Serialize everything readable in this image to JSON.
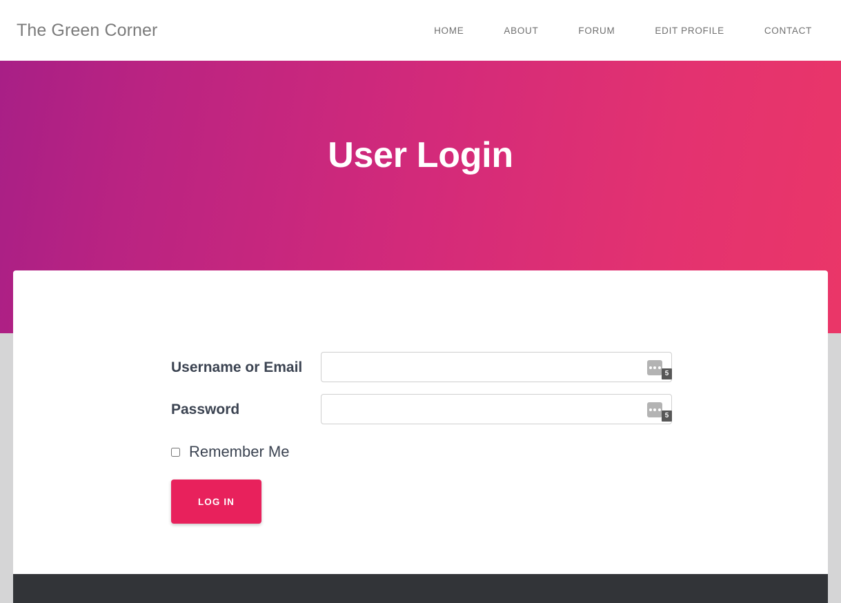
{
  "header": {
    "site_title": "The Green Corner",
    "nav": [
      {
        "label": "HOME"
      },
      {
        "label": "ABOUT"
      },
      {
        "label": "FORUM"
      },
      {
        "label": "EDIT PROFILE"
      },
      {
        "label": "CONTACT"
      }
    ]
  },
  "hero": {
    "title": "User Login",
    "gradient_start": "#a81f86",
    "gradient_end": "#ea3668"
  },
  "form": {
    "username": {
      "label": "Username or Email",
      "value": "",
      "placeholder": "",
      "password_manager_icon": "three-dots-icon",
      "password_manager_count": "5"
    },
    "password": {
      "label": "Password",
      "value": "",
      "placeholder": "",
      "password_manager_icon": "three-dots-icon",
      "password_manager_count": "5"
    },
    "remember": {
      "label": "Remember Me",
      "checked": false
    },
    "submit": {
      "label": "LOG IN",
      "color": "#e8215c"
    }
  },
  "footer": {
    "background": "#323438"
  }
}
